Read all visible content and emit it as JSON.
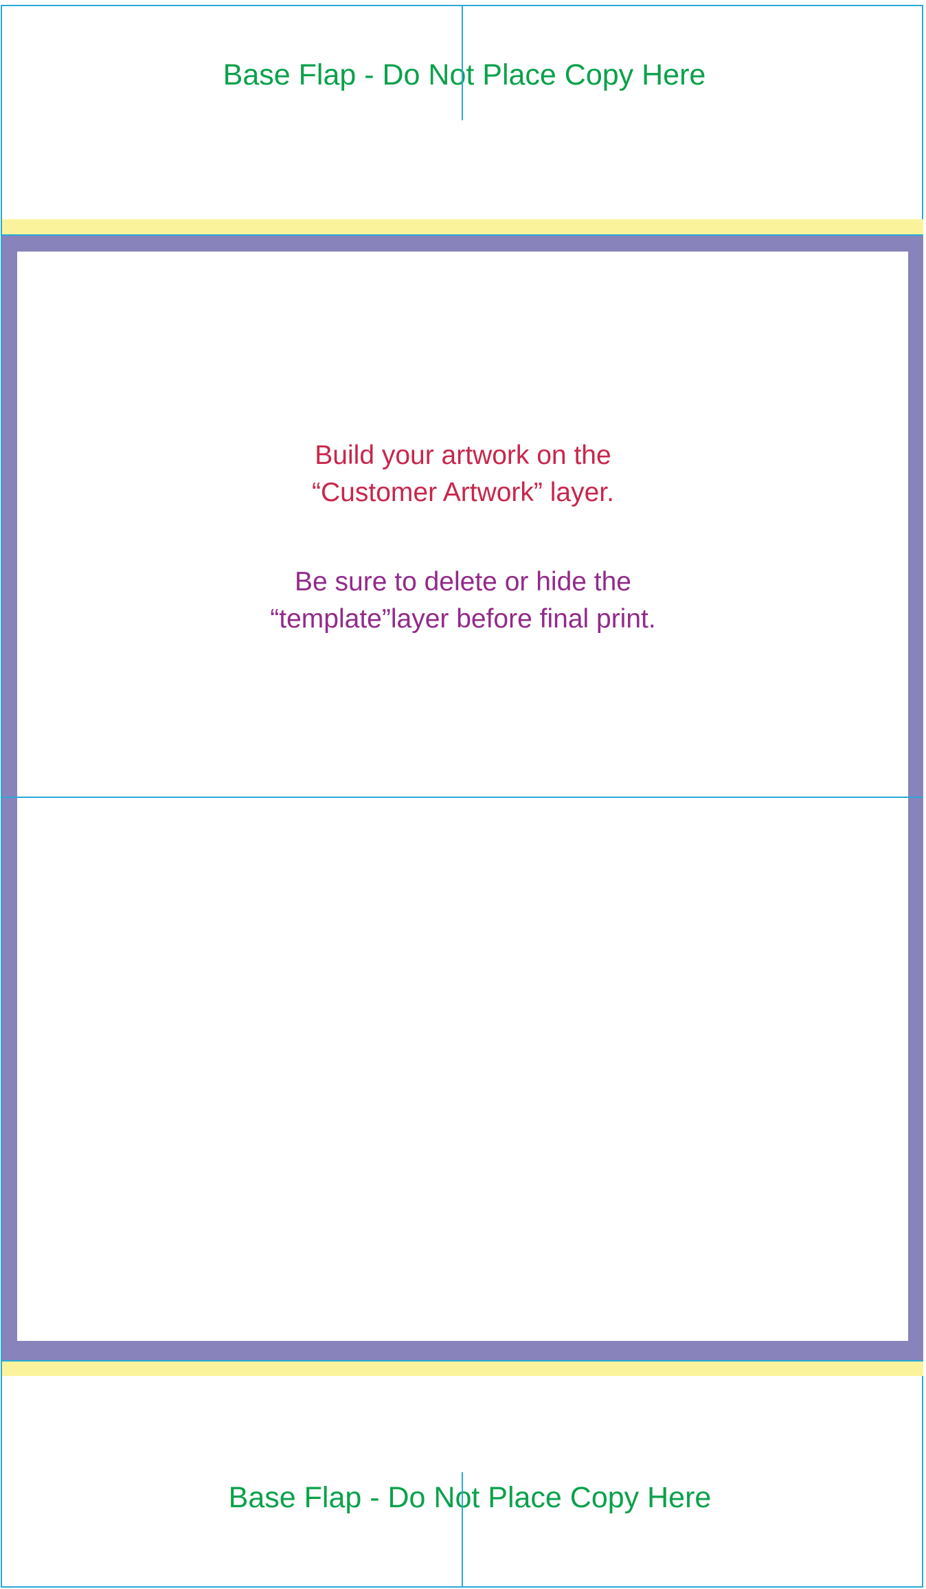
{
  "flaps": {
    "top_label": "Base Flap - Do Not Place Copy Here",
    "bottom_label": "Base Flap - Do Not Place Copy Here"
  },
  "instructions": {
    "artwork_line1": "Build your artwork on the",
    "artwork_line2": "“Customer Artwork” layer.",
    "template_line1": "Be sure to delete or hide the",
    "template_line2": "“template”layer before final print."
  },
  "colors": {
    "guide_line": "#29a8d8",
    "bleed_band": "#fbf39b",
    "panel_border": "#8883bb",
    "flap_text": "#0aa14a",
    "artwork_text": "#c8264b",
    "template_text": "#922a8a"
  }
}
